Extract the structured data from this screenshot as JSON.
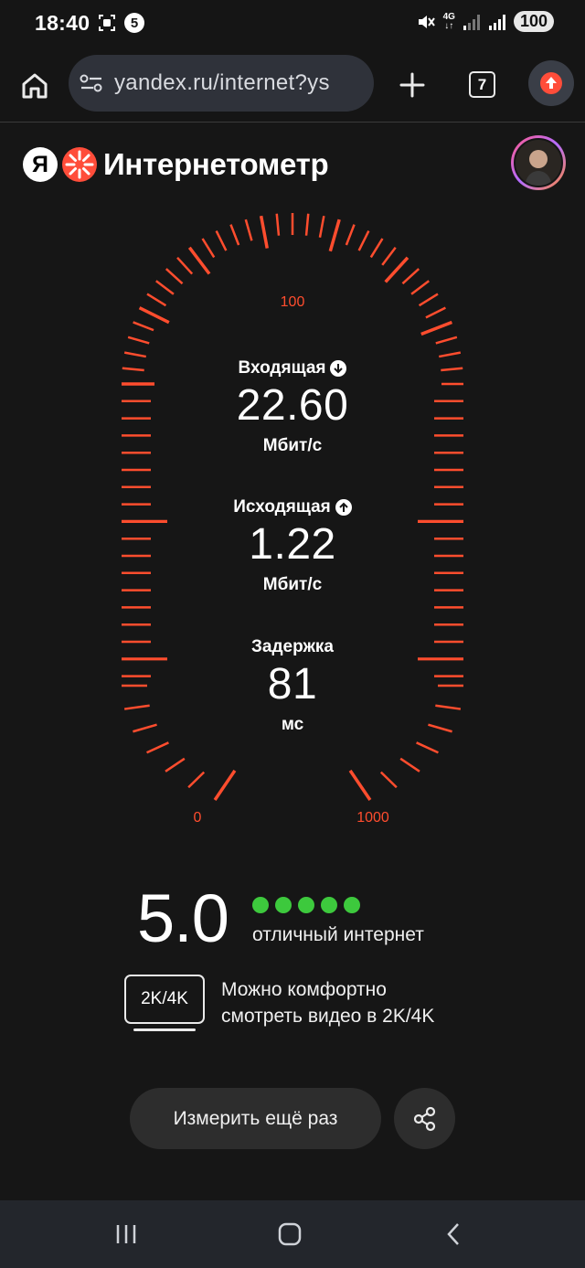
{
  "status_bar": {
    "time": "18:40",
    "notification_badge": "5",
    "network_type": "4G",
    "battery": "100"
  },
  "browser": {
    "url": "yandex.ru/internet?ys",
    "tab_count": "7"
  },
  "header": {
    "logo_letter": "Я",
    "title": "Интернетометр"
  },
  "gauge": {
    "scale_labels": {
      "min": "0",
      "mid": "100",
      "max": "1000"
    },
    "accent_color": "#ff4d2e"
  },
  "readouts": {
    "download": {
      "label": "Входящая",
      "value": "22.60",
      "unit": "Мбит/с"
    },
    "upload": {
      "label": "Исходящая",
      "value": "1.22",
      "unit": "Мбит/с"
    },
    "latency": {
      "label": "Задержка",
      "value": "81",
      "unit": "мс"
    }
  },
  "rating": {
    "score": "5.0",
    "dots_filled": 5,
    "dot_color": "#3dc93d",
    "text": "отличный интернет"
  },
  "quality": {
    "badge": "2K/4K",
    "line1": "Можно комфортно",
    "line2": "смотреть видео в 2K/4K"
  },
  "actions": {
    "measure_again": "Измерить ещё раз"
  }
}
